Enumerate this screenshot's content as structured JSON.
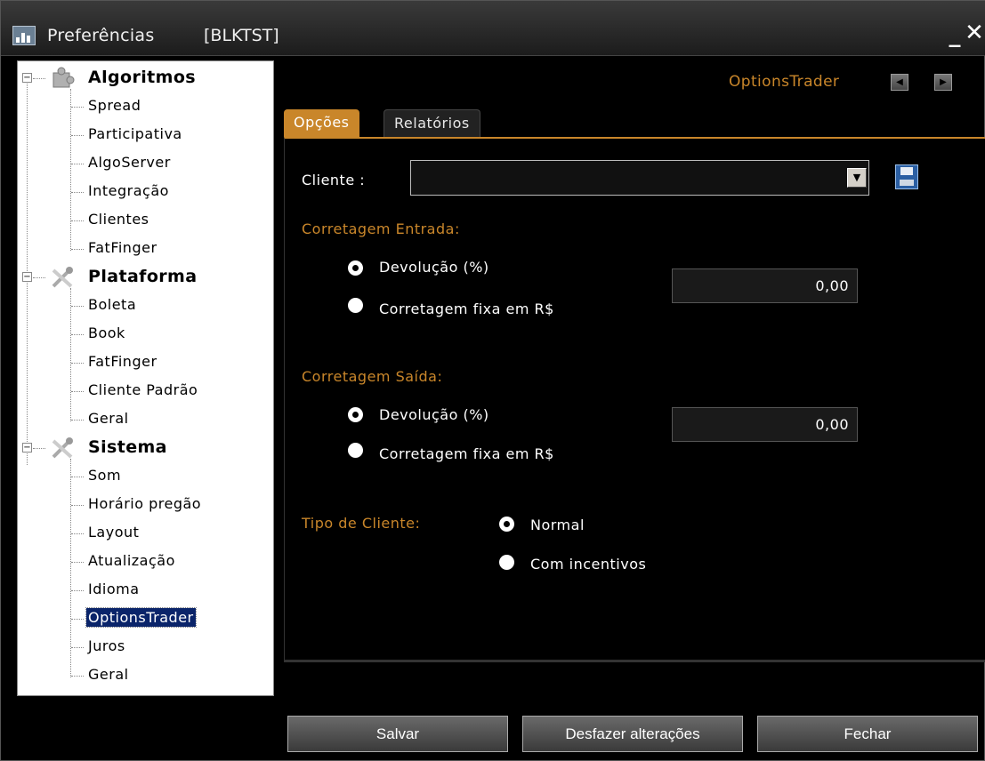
{
  "window": {
    "title": "Preferências",
    "tag": "[BLKTST]",
    "minimize_glyph": "_",
    "close_glyph": "✕"
  },
  "tree": {
    "groups": [
      {
        "label": "Algoritmos",
        "icon": "puzzle-icon",
        "children": [
          "Spread",
          "Participativa",
          "AlgoServer",
          "Integração",
          "Clientes",
          "FatFinger"
        ]
      },
      {
        "label": "Plataforma",
        "icon": "tools-icon",
        "children": [
          "Boleta",
          "Book",
          "FatFinger",
          "Cliente Padrão",
          "Geral"
        ]
      },
      {
        "label": "Sistema",
        "icon": "tools-icon",
        "children": [
          "Som",
          "Horário pregão",
          "Layout",
          "Atualização",
          "Idioma",
          "OptionsTrader",
          "Juros",
          "Geral"
        ]
      }
    ],
    "selected": "OptionsTrader"
  },
  "header": {
    "title": "OptionsTrader"
  },
  "tabs": [
    {
      "label": "Opções",
      "active": true
    },
    {
      "label": "Relatórios",
      "active": false
    }
  ],
  "form": {
    "cliente_label": "Cliente :",
    "cliente_value": "",
    "entrada": {
      "title": "Corretagem Entrada:",
      "option1": "Devolução (%)",
      "option2": "Corretagem fixa em R$",
      "selected": "option1",
      "value": "0,00"
    },
    "saida": {
      "title": "Corretagem Saída:",
      "option1": "Devolução (%)",
      "option2": "Corretagem fixa em R$",
      "selected": "option1",
      "value": "0,00"
    },
    "tipo": {
      "title": "Tipo de Cliente:",
      "option1": "Normal",
      "option2": "Com incentivos",
      "selected": "option1"
    }
  },
  "buttons": {
    "save": "Salvar",
    "undo": "Desfazer alterações",
    "close": "Fechar"
  },
  "colors": {
    "accent": "#c9862a",
    "selection": "#0a246a"
  }
}
